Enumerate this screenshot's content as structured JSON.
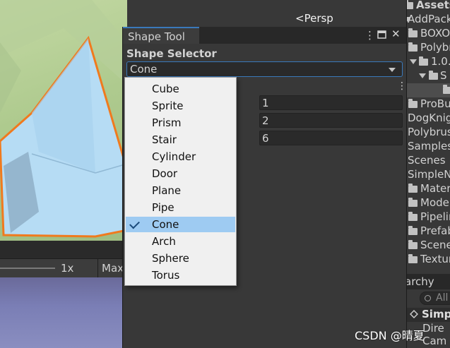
{
  "scene_view": {
    "camera_label": "Persp",
    "zoom_label": "1x",
    "max_tab_label": "Max"
  },
  "shape_tool": {
    "window_title": "Shape Tool",
    "section_header": "Shape Selector",
    "selected_shape": "Cone",
    "fields": [
      "1",
      "2",
      "6"
    ],
    "menu_options": [
      {
        "label": "Cube",
        "selected": false
      },
      {
        "label": "Sprite",
        "selected": false
      },
      {
        "label": "Prism",
        "selected": false
      },
      {
        "label": "Stair",
        "selected": false
      },
      {
        "label": "Cylinder",
        "selected": false
      },
      {
        "label": "Door",
        "selected": false
      },
      {
        "label": "Plane",
        "selected": false
      },
      {
        "label": "Pipe",
        "selected": false
      },
      {
        "label": "Cone",
        "selected": true
      },
      {
        "label": "Arch",
        "selected": false
      },
      {
        "label": "Sphere",
        "selected": false
      },
      {
        "label": "Torus",
        "selected": false
      }
    ]
  },
  "project": {
    "items": [
      {
        "label": "Assets"
      },
      {
        "label": "AddPack"
      },
      {
        "label": "BOXO"
      },
      {
        "label": "Polybr"
      },
      {
        "label": "1.0."
      },
      {
        "label": "S"
      },
      {
        "label": ""
      },
      {
        "label": "ProBu"
      },
      {
        "label": "DogKnig"
      },
      {
        "label": "Polybrus"
      },
      {
        "label": "Samples"
      },
      {
        "label": "Scenes"
      },
      {
        "label": "SimpleN"
      },
      {
        "label": "Mater"
      },
      {
        "label": "Model"
      },
      {
        "label": "Pipelin"
      },
      {
        "label": "Prefab"
      },
      {
        "label": "Scene"
      },
      {
        "label": "Textur"
      }
    ]
  },
  "hierarchy": {
    "tab_label": "archy",
    "search_placeholder": "All",
    "scene_name": "Simpl",
    "children": [
      "Dire",
      "Cam"
    ]
  },
  "watermark": "CSDN @晴夏"
}
